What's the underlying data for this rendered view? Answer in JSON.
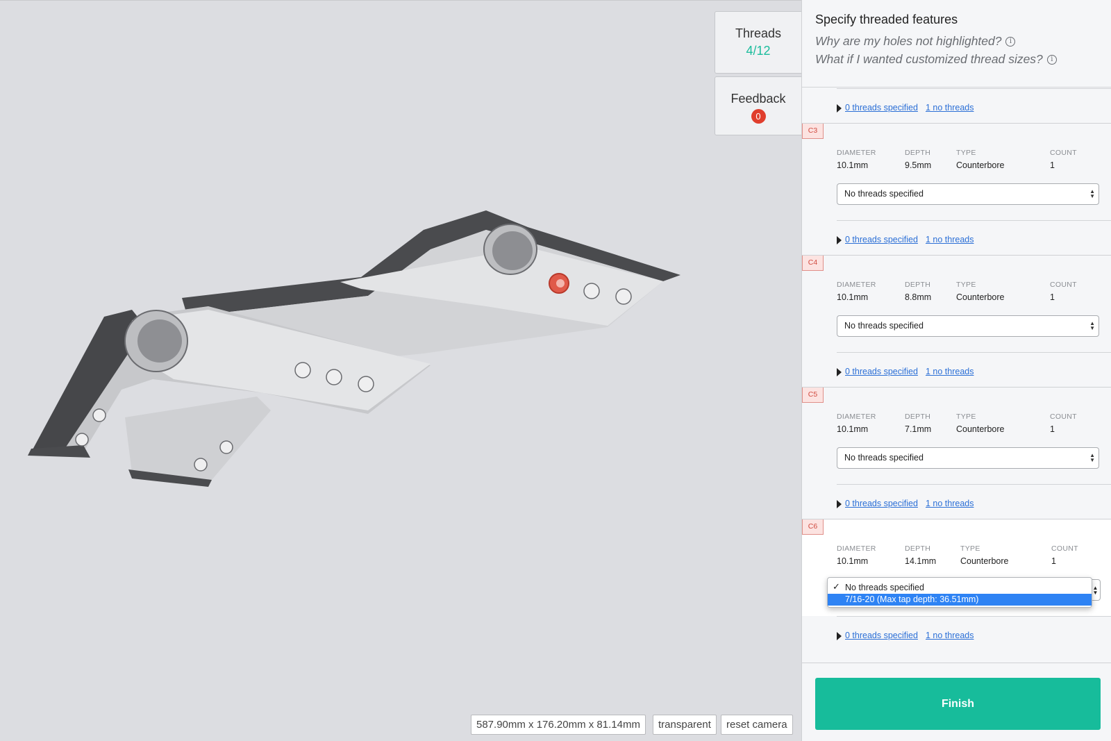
{
  "panel": {
    "title": "Specify threaded features",
    "help_holes": "Why are my holes not highlighted?",
    "help_custom": "What if I wanted customized thread sizes?",
    "info_icon": "i",
    "finish_label": "Finish"
  },
  "tabs": {
    "threads_label": "Threads",
    "threads_count": "4/12",
    "feedback_label": "Feedback",
    "feedback_count": "0"
  },
  "summary": {
    "specified": "0 threads specified",
    "none": "1 no threads"
  },
  "columns": {
    "diameter": "DIAMETER",
    "depth": "DEPTH",
    "type": "TYPE",
    "count": "COUNT"
  },
  "features": [
    {
      "tag": "C3",
      "diameter": "10.1mm",
      "depth": "9.5mm",
      "type": "Counterbore",
      "count": "1",
      "selected": "No threads specified"
    },
    {
      "tag": "C4",
      "diameter": "10.1mm",
      "depth": "8.8mm",
      "type": "Counterbore",
      "count": "1",
      "selected": "No threads specified"
    },
    {
      "tag": "C5",
      "diameter": "10.1mm",
      "depth": "7.1mm",
      "type": "Counterbore",
      "count": "1",
      "selected": "No threads specified"
    },
    {
      "tag": "C6",
      "diameter": "10.1mm",
      "depth": "14.1mm",
      "type": "Counterbore",
      "count": "1",
      "selected": "No threads specified"
    }
  ],
  "dropdown": {
    "options": [
      "No threads specified",
      "7/16-20 (Max tap depth: 36.51mm)"
    ],
    "checked_index": 0,
    "highlighted_index": 1
  },
  "viewport": {
    "dimensions": "587.90mm x 176.20mm x 81.14mm",
    "transparent_label": "transparent",
    "reset_label": "reset camera"
  },
  "colors": {
    "accent": "#17bc9b",
    "link": "#2b6fd6",
    "badge": "#e03e2d",
    "highlight_hole": "#e05a4a"
  }
}
